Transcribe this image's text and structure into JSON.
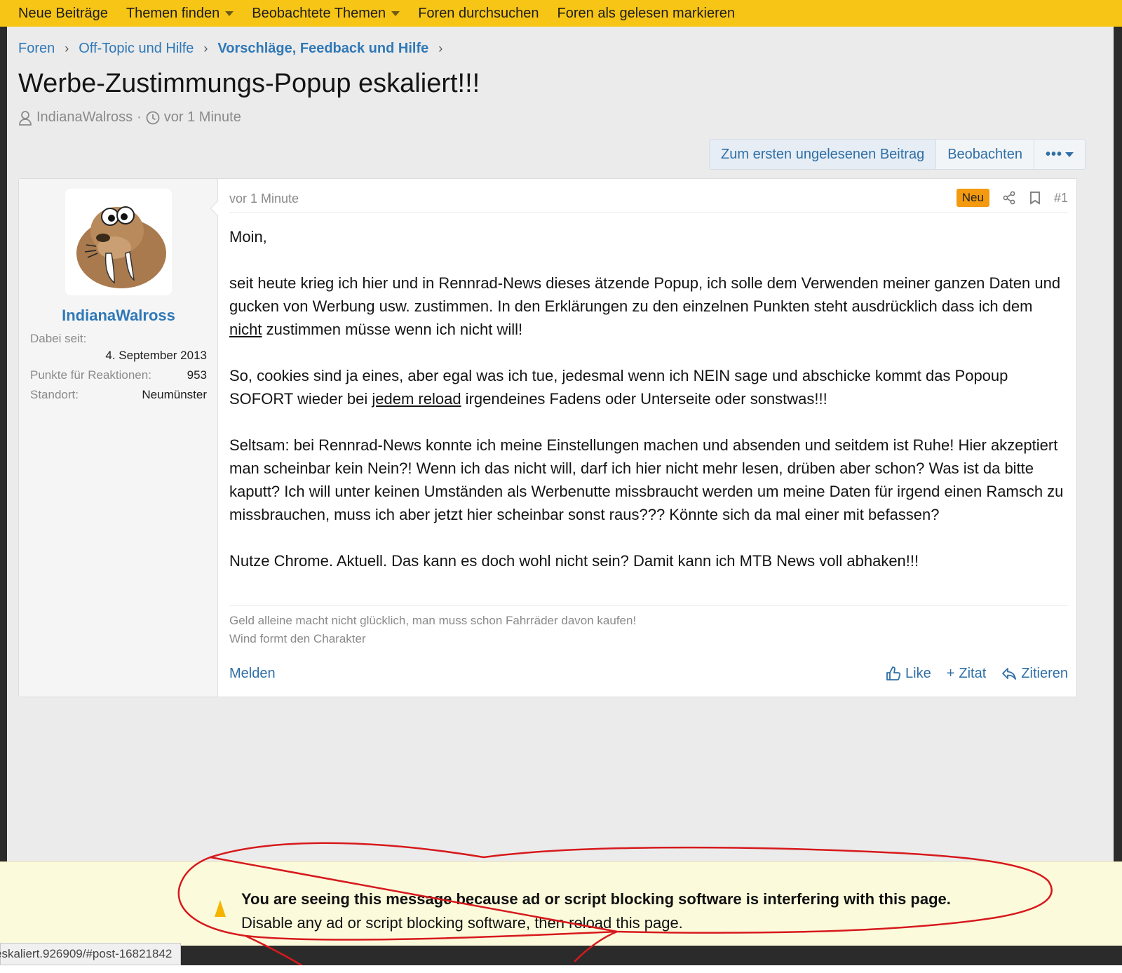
{
  "topnav": {
    "items": [
      {
        "label": "Neue Beiträge"
      },
      {
        "label": "Themen finden"
      },
      {
        "label": "Beobachtete Themen"
      },
      {
        "label": "Foren durchsuchen"
      },
      {
        "label": "Foren als gelesen markieren"
      }
    ]
  },
  "breadcrumb": [
    "Foren",
    "Off-Topic und Hilfe",
    "Vorschläge, Feedback und Hilfe"
  ],
  "thread": {
    "title": "Werbe-Zustimmungs-Popup eskaliert!!!",
    "author": "IndianaWalross",
    "time": "vor 1 Minute"
  },
  "buttons": {
    "first_unread": "Zum ersten ungelesenen Beitrag",
    "watch": "Beobachten"
  },
  "user": {
    "name": "IndianaWalross",
    "joined_label": "Dabei seit:",
    "joined_value": "4. September 2013",
    "points_label": "Punkte für Reaktionen:",
    "points_value": "953",
    "location_label": "Standort:",
    "location_value": "Neumünster"
  },
  "post": {
    "time": "vor 1 Minute",
    "badge": "Neu",
    "number": "#1",
    "greeting": "Moin,",
    "p1_a": "seit heute krieg ich hier und in Rennrad-News dieses ätzende Popup, ich solle dem Verwenden meiner ganzen Daten und gucken von Werbung usw. zustimmen. In den Erklärungen zu den einzelnen Punkten steht ausdrücklich dass ich dem ",
    "p1_u": "nicht",
    "p1_b": " zustimmen müsse wenn ich nicht will!",
    "p2_a": "So, cookies sind ja eines, aber egal was ich tue, jedesmal wenn ich NEIN sage und abschicke kommt das Popoup SOFORT wieder bei ",
    "p2_u": "jedem reload",
    "p2_b": " irgendeines Fadens oder Unterseite oder sonstwas!!!",
    "p3": "Seltsam: bei Rennrad-News konnte ich meine Einstellungen machen und absenden und seitdem ist Ruhe! Hier akzeptiert man scheinbar kein Nein?! Wenn ich das nicht will, darf ich hier nicht mehr lesen, drüben aber schon? Was ist da bitte kaputt? Ich will unter keinen Umständen als Werbenutte missbraucht werden um meine Daten für irgend einen Ramsch zu missbrauchen, muss ich aber jetzt hier scheinbar sonst raus??? Könnte sich da mal einer mit befassen?",
    "p4": "Nutze Chrome. Aktuell. Das kann es doch wohl nicht sein? Damit kann ich MTB News voll abhaken!!!",
    "sig1": "Geld alleine macht nicht glücklich, man muss schon Fahrräder davon kaufen!",
    "sig2": "Wind formt den Charakter",
    "report": "Melden",
    "like": "Like",
    "quote_plus": "Zitat",
    "reply": "Zitieren"
  },
  "banner": {
    "line1": "You are seeing this message because ad or script blocking software is interfering with this page.",
    "line2": "Disable any ad or script blocking software, then reload this page."
  },
  "statusbar": {
    "url": "eskaliert.926909/#post-16821842"
  },
  "colors": {
    "accent_yellow": "#f7c516",
    "link_blue": "#2f78b7",
    "badge_orange": "#f39a10",
    "annotation_red": "#d7191c"
  }
}
